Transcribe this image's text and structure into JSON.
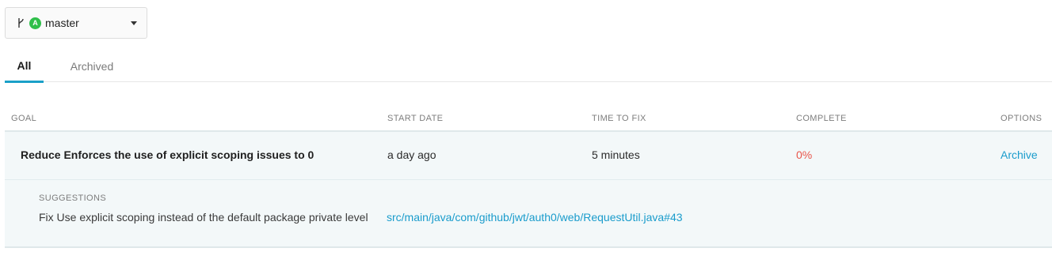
{
  "branch": {
    "icon": "branch-icon",
    "badge": "A",
    "name": "master",
    "badge_color": "#2fbf4a"
  },
  "tabs": [
    {
      "label": "All",
      "active": true
    },
    {
      "label": "Archived",
      "active": false
    }
  ],
  "table": {
    "columns": [
      "GOAL",
      "START DATE",
      "TIME TO FIX",
      "COMPLETE",
      "OPTIONS"
    ],
    "rows": [
      {
        "goal": "Reduce Enforces the use of explicit scoping issues to 0",
        "start_date": "a day ago",
        "time_to_fix": "5 minutes",
        "complete": "0%",
        "option": "Archive",
        "suggestions": {
          "label": "SUGGESTIONS",
          "text": "Fix Use explicit scoping instead of the default package private level",
          "link": "src/main/java/com/github/jwt/auth0/web/RequestUtil.java#43"
        }
      }
    ]
  },
  "colors": {
    "accent": "#1a9ccc",
    "complete_low": "#e8554b",
    "row_bg": "#f3f8f9"
  }
}
